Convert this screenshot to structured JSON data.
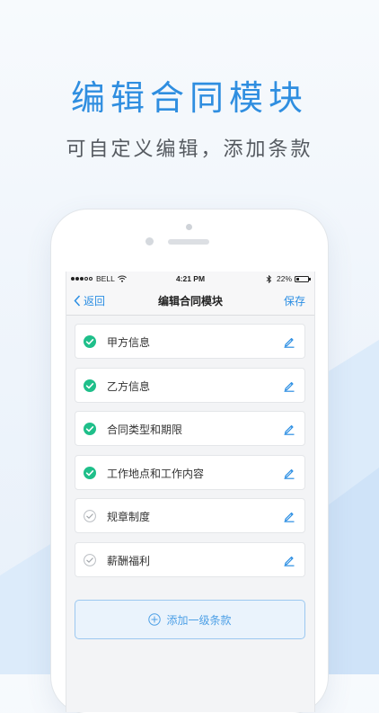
{
  "promo": {
    "headline": "编辑合同模块",
    "subhead": "可自定义编辑，添加条款"
  },
  "status_bar": {
    "carrier": "BELL",
    "time": "4:21 PM",
    "battery_percent": "22%",
    "battery_level": 0.22
  },
  "nav": {
    "back_label": "返回",
    "title": "编辑合同模块",
    "save_label": "保存"
  },
  "clauses": [
    {
      "label": "甲方信息",
      "checked": true
    },
    {
      "label": "乙方信息",
      "checked": true
    },
    {
      "label": "合同类型和期限",
      "checked": true
    },
    {
      "label": "工作地点和工作内容",
      "checked": true
    },
    {
      "label": "规章制度",
      "checked": false
    },
    {
      "label": "薪酬福利",
      "checked": false
    }
  ],
  "add_button": {
    "label": "添加一级条款"
  },
  "colors": {
    "accent": "#2b8ee3",
    "check_green": "#1fbf8a",
    "headline_blue": "#2f8ee0"
  },
  "icons": {
    "check": "check-circle-icon",
    "edit": "pencil-icon",
    "back": "chevron-left-icon",
    "add": "plus-circle-icon"
  }
}
